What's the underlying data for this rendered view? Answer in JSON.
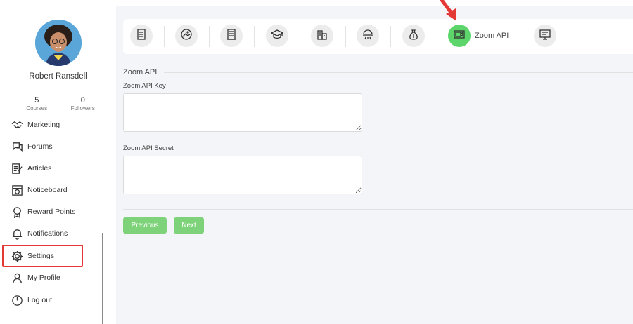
{
  "user": {
    "name": "Robert Ransdell",
    "courses_count": "5",
    "courses_label": "Courses",
    "followers_count": "0",
    "followers_label": "Followers"
  },
  "sidebar": {
    "items": [
      {
        "label": "Marketing",
        "icon": "handshake-icon"
      },
      {
        "label": "Forums",
        "icon": "chat-icon"
      },
      {
        "label": "Articles",
        "icon": "article-icon"
      },
      {
        "label": "Noticeboard",
        "icon": "noticeboard-icon"
      },
      {
        "label": "Reward Points",
        "icon": "award-icon"
      },
      {
        "label": "Notifications",
        "icon": "bell-icon"
      },
      {
        "label": "Settings",
        "icon": "gear-icon"
      },
      {
        "label": "My Profile",
        "icon": "user-icon"
      },
      {
        "label": "Log out",
        "icon": "power-icon"
      }
    ]
  },
  "tabs": {
    "items": [
      {
        "icon": "document-icon"
      },
      {
        "icon": "image-icon"
      },
      {
        "icon": "book-icon"
      },
      {
        "icon": "graduation-cap-icon"
      },
      {
        "icon": "bank-icon"
      },
      {
        "icon": "web-icon"
      },
      {
        "icon": "money-bag-icon"
      },
      {
        "icon": "zoom-camera-icon",
        "label": "Zoom API",
        "active": true
      },
      {
        "icon": "monitor-icon"
      }
    ],
    "active_label": "Zoom API"
  },
  "form": {
    "section_title": "Zoom API",
    "api_key_label": "Zoom API Key",
    "api_key_value": "",
    "api_secret_label": "Zoom API Secret",
    "api_secret_value": "",
    "previous_label": "Previous",
    "next_label": "Next"
  },
  "colors": {
    "accent_green": "#5cd66a",
    "button_green": "#7ed37a",
    "highlight_red": "#e53935"
  }
}
